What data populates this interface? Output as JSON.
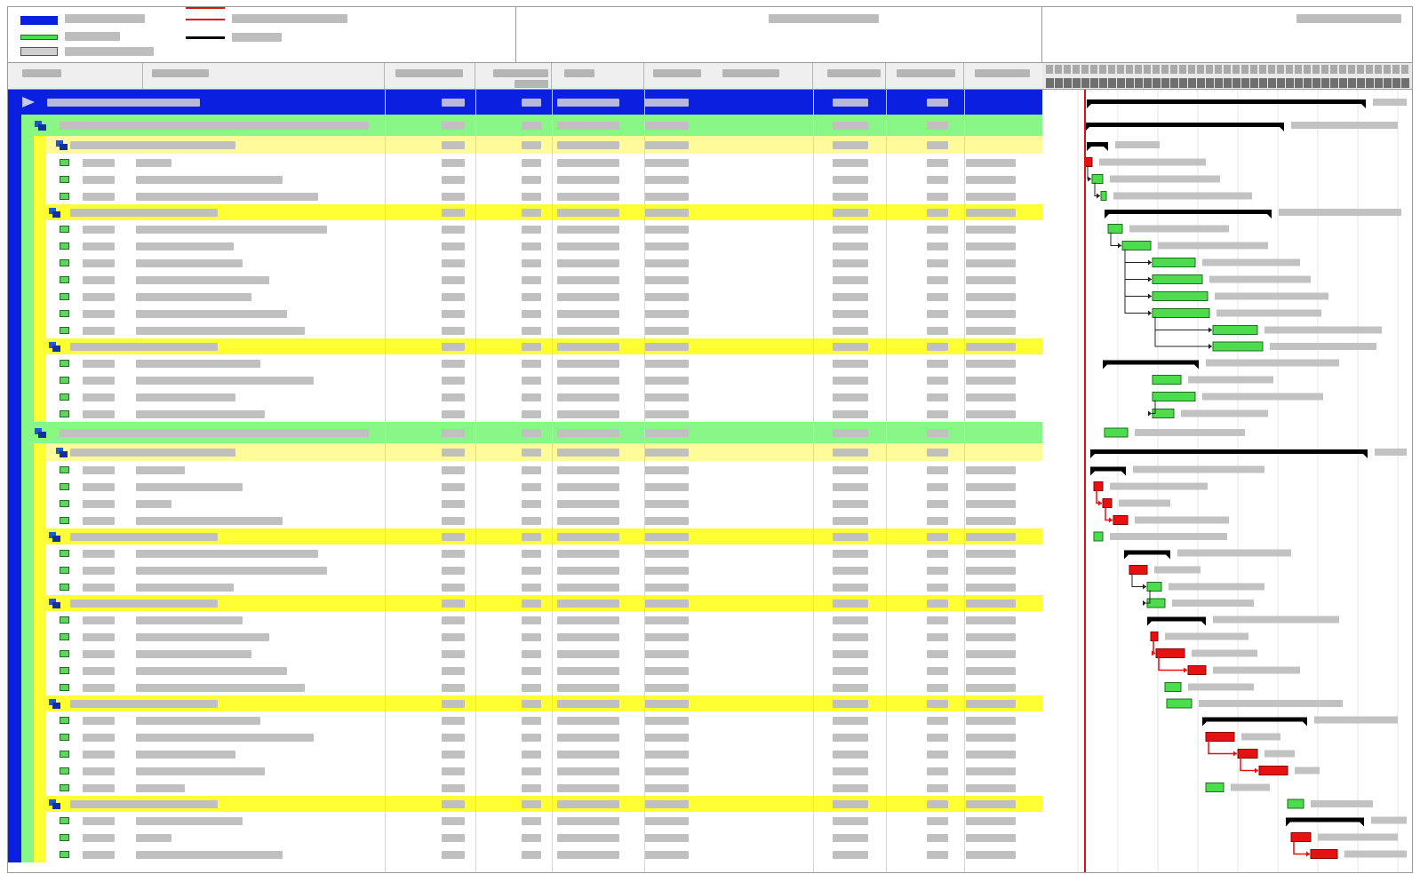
{
  "colors": {
    "project_bar": "#0a1fe0",
    "phase_row": "#88f788",
    "group_row": "#ffff33",
    "subgroup_row": "#fffb9a",
    "task_bar": "#4ddc4d",
    "critical_bar": "#e81010",
    "summary_bar": "#000000",
    "status_line": "#e01010",
    "placeholder_text": "#bdbdbd"
  },
  "legend": {
    "items": [
      {
        "swatch": "project-swatch"
      },
      {
        "swatch": "task-swatch"
      },
      {
        "swatch": "baseline-swatch"
      },
      {
        "swatch": "critical-line"
      },
      {
        "swatch": "status-line"
      },
      {
        "swatch": "summary-line"
      }
    ]
  },
  "columns": [
    {
      "name": "id"
    },
    {
      "name": "task-name"
    },
    {
      "name": "duration"
    },
    {
      "name": "work"
    },
    {
      "name": "start"
    },
    {
      "name": "finish"
    },
    {
      "name": "predecessors"
    },
    {
      "name": "percent-complete"
    },
    {
      "name": "resources"
    }
  ],
  "icons": {
    "project": "project-flag-icon",
    "summary": "summary-task-icon",
    "task": "task-icon"
  },
  "rows": [
    {
      "level": 0,
      "kind": "project"
    },
    {
      "level": 1,
      "kind": "phase"
    },
    {
      "level": 2,
      "kind": "subgroup"
    },
    {
      "level": 3,
      "kind": "task"
    },
    {
      "level": 3,
      "kind": "task"
    },
    {
      "level": 3,
      "kind": "task"
    },
    {
      "level": 2,
      "kind": "group"
    },
    {
      "level": 3,
      "kind": "task"
    },
    {
      "level": 3,
      "kind": "task"
    },
    {
      "level": 3,
      "kind": "task"
    },
    {
      "level": 3,
      "kind": "task"
    },
    {
      "level": 3,
      "kind": "task"
    },
    {
      "level": 3,
      "kind": "task"
    },
    {
      "level": 3,
      "kind": "task"
    },
    {
      "level": 2,
      "kind": "group"
    },
    {
      "level": 3,
      "kind": "task"
    },
    {
      "level": 3,
      "kind": "task"
    },
    {
      "level": 3,
      "kind": "task"
    },
    {
      "level": 3,
      "kind": "task"
    },
    {
      "level": 1,
      "kind": "phase"
    },
    {
      "level": 2,
      "kind": "subgroup"
    },
    {
      "level": 3,
      "kind": "task"
    },
    {
      "level": 3,
      "kind": "task"
    },
    {
      "level": 3,
      "kind": "task"
    },
    {
      "level": 3,
      "kind": "task"
    },
    {
      "level": 2,
      "kind": "group"
    },
    {
      "level": 3,
      "kind": "task"
    },
    {
      "level": 3,
      "kind": "task"
    },
    {
      "level": 3,
      "kind": "task"
    },
    {
      "level": 2,
      "kind": "group"
    },
    {
      "level": 3,
      "kind": "task"
    },
    {
      "level": 3,
      "kind": "task"
    },
    {
      "level": 3,
      "kind": "task"
    },
    {
      "level": 3,
      "kind": "task"
    },
    {
      "level": 3,
      "kind": "task"
    },
    {
      "level": 2,
      "kind": "group"
    },
    {
      "level": 3,
      "kind": "task"
    },
    {
      "level": 3,
      "kind": "task"
    },
    {
      "level": 3,
      "kind": "task"
    },
    {
      "level": 3,
      "kind": "task"
    },
    {
      "level": 3,
      "kind": "task"
    },
    {
      "level": 2,
      "kind": "group"
    },
    {
      "level": 3,
      "kind": "task"
    },
    {
      "level": 3,
      "kind": "task"
    },
    {
      "level": 3,
      "kind": "task"
    }
  ]
}
